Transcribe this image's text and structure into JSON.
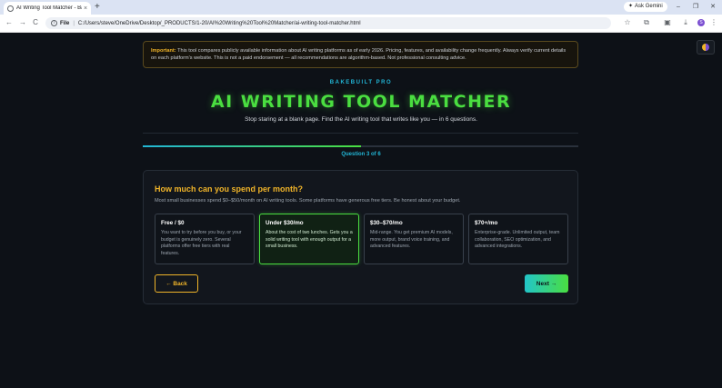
{
  "browser": {
    "tab_title": "AI Writing Tool Matcher - Bake",
    "tab_close": "×",
    "new_tab": "+",
    "gemini_label": "Ask Gemini",
    "minimize": "–",
    "maximize": "❐",
    "close": "✕",
    "back": "←",
    "forward": "→",
    "reload": "C",
    "url_scheme": "File",
    "url_separator": "|",
    "url": "C:/Users/steve/OneDrive/Desktop/_PRODUCTS/1-20/AI%20Writing%20Tool%20Matcher/ai-writing-tool-matcher.html",
    "avatar_letter": "S"
  },
  "notice": {
    "label": "Important:",
    "text": " This tool compares publicly available information about AI writing platforms as of early 2026. Pricing, features, and availability change frequently. Always verify current details on each platform's website. This is not a paid endorsement — all recommendations are algorithm-based. Not professional consulting advice."
  },
  "header": {
    "brand": "BAKEBUILT PRO",
    "title": "AI WRITING TOOL MATCHER",
    "subtitle": "Stop staring at a blank page. Find the AI writing tool that writes like you — in 6 questions."
  },
  "progress": {
    "current": 3,
    "total": 6,
    "fraction": 0.5,
    "label": "Question 3 of 6"
  },
  "question": {
    "title": "How much can you spend per month?",
    "description": "Most small businesses spend $0–$50/month on AI writing tools. Some platforms have generous free tiers. Be honest about your budget.",
    "selected_index": 1,
    "options": [
      {
        "label": "Free / $0",
        "desc": "You want to try before you buy, or your budget is genuinely zero. Several platforms offer free tiers with real features."
      },
      {
        "label": "Under $30/mo",
        "desc": "About the cost of two lunches. Gets you a solid writing tool with enough output for a small business."
      },
      {
        "label": "$30–$70/mo",
        "desc": "Mid-range. You get premium AI models, more output, brand voice training, and advanced features."
      },
      {
        "label": "$70+/mo",
        "desc": "Enterprise-grade. Unlimited output, team collaboration, SEO optimization, and advanced integrations."
      }
    ]
  },
  "nav": {
    "back_label": "← Back",
    "next_label": "Next →"
  },
  "colors": {
    "accent_green": "#4ade40",
    "accent_cyan": "#22b6d6",
    "accent_gold": "#f0b429",
    "background": "#0d1117"
  }
}
